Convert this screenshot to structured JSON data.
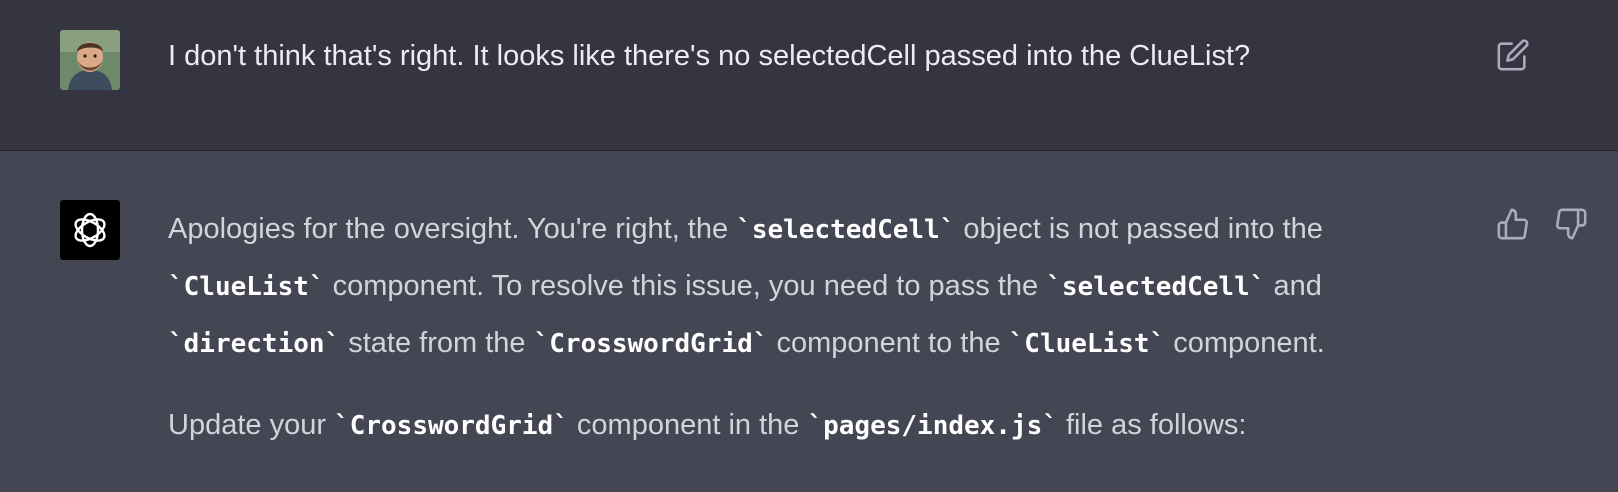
{
  "user_message": {
    "text": "I don't think that's right. It looks like there's no selectedCell passed into the ClueList?",
    "avatar": "user-photo",
    "edit_icon": "edit-icon"
  },
  "assistant_message": {
    "avatar": "openai-logo-icon",
    "p1": {
      "t1": "Apologies for the oversight. You're right, the ",
      "c1": "`selectedCell`",
      "t2": " object is not passed into the ",
      "c2": "`ClueList`",
      "t3": " component. To resolve this issue, you need to pass the ",
      "c3": "`selectedCell`",
      "t4": " and ",
      "c4": "`direction`",
      "t5": " state from the ",
      "c5": "`CrosswordGrid`",
      "t6": " component to the ",
      "c6": "`ClueList`",
      "t7": " component."
    },
    "p2": {
      "t1": "Update your ",
      "c1": "`CrosswordGrid`",
      "t2": " component in the ",
      "c2": "`pages/index.js`",
      "t3": " file as follows:"
    },
    "feedback": {
      "up_icon": "thumbs-up-icon",
      "down_icon": "thumbs-down-icon"
    }
  },
  "colors": {
    "user_bg": "#343541",
    "assistant_bg": "#444654",
    "text": "#d1d5db"
  }
}
